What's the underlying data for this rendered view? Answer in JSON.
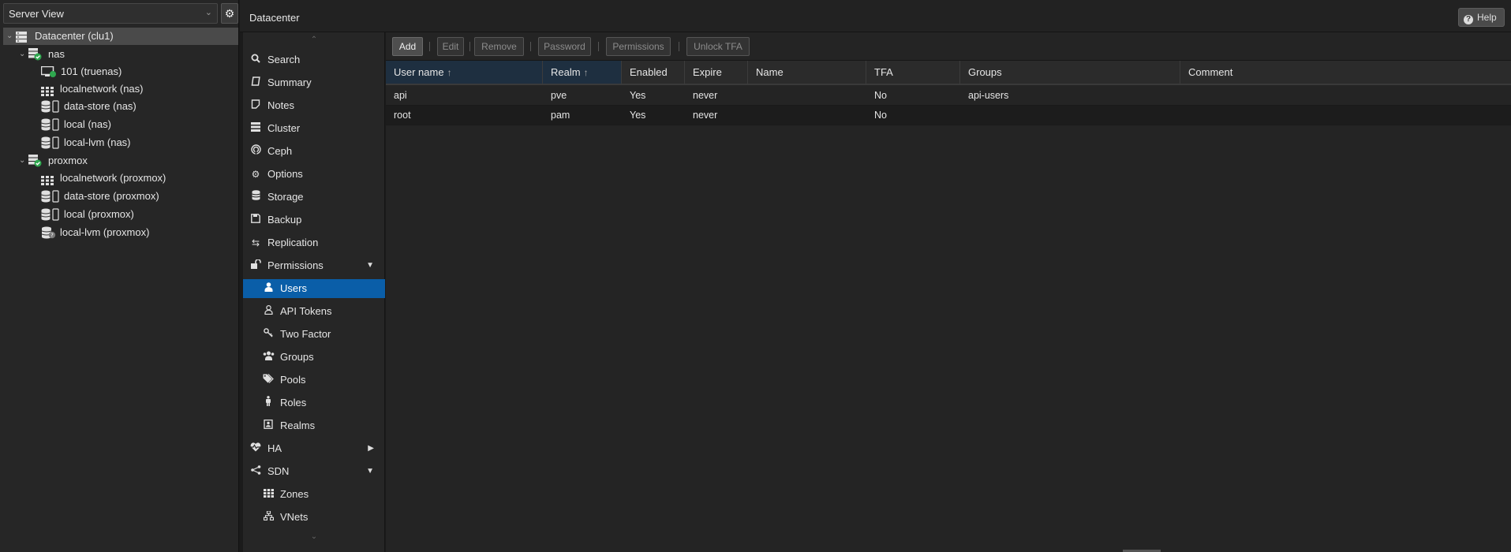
{
  "left_panel": {
    "view_select": {
      "value": "Server View"
    },
    "tree": [
      {
        "label": "Datacenter (clu1)",
        "type": "datacenter",
        "depth": 0,
        "expanded": true,
        "selected": true
      },
      {
        "label": "nas",
        "type": "node",
        "depth": 1,
        "expanded": true
      },
      {
        "label": "101 (truenas)",
        "type": "vm",
        "depth": 2
      },
      {
        "label": "localnetwork (nas)",
        "type": "sdn",
        "depth": 2
      },
      {
        "label": "data-store (nas)",
        "type": "storage",
        "depth": 2
      },
      {
        "label": "local (nas)",
        "type": "storage",
        "depth": 2
      },
      {
        "label": "local-lvm (nas)",
        "type": "storage",
        "depth": 2
      },
      {
        "label": "proxmox",
        "type": "node",
        "depth": 1,
        "expanded": true
      },
      {
        "label": "localnetwork (proxmox)",
        "type": "sdn",
        "depth": 2
      },
      {
        "label": "data-store (proxmox)",
        "type": "storage",
        "depth": 2
      },
      {
        "label": "local (proxmox)",
        "type": "storage",
        "depth": 2
      },
      {
        "label": "local-lvm (proxmox)",
        "type": "storage-unknown",
        "depth": 2
      }
    ]
  },
  "header": {
    "title": "Datacenter",
    "help_label": "Help"
  },
  "nav": {
    "items": [
      {
        "label": "Search",
        "icon": "search-icon",
        "sub": false
      },
      {
        "label": "Summary",
        "icon": "book-icon",
        "sub": false
      },
      {
        "label": "Notes",
        "icon": "notes-icon",
        "sub": false
      },
      {
        "label": "Cluster",
        "icon": "server-icon",
        "sub": false
      },
      {
        "label": "Ceph",
        "icon": "ceph-icon",
        "sub": false
      },
      {
        "label": "Options",
        "icon": "gear-icon",
        "sub": false
      },
      {
        "label": "Storage",
        "icon": "database-icon",
        "sub": false
      },
      {
        "label": "Backup",
        "icon": "floppy-icon",
        "sub": false
      },
      {
        "label": "Replication",
        "icon": "retweet-icon",
        "sub": false
      },
      {
        "label": "Permissions",
        "icon": "unlock-icon",
        "sub": false,
        "expander": "down"
      },
      {
        "label": "Users",
        "icon": "user-icon",
        "sub": true,
        "selected": true
      },
      {
        "label": "API Tokens",
        "icon": "user-outline-icon",
        "sub": true
      },
      {
        "label": "Two Factor",
        "icon": "key-icon",
        "sub": true
      },
      {
        "label": "Groups",
        "icon": "users-icon",
        "sub": true
      },
      {
        "label": "Pools",
        "icon": "tags-icon",
        "sub": true
      },
      {
        "label": "Roles",
        "icon": "male-icon",
        "sub": true
      },
      {
        "label": "Realms",
        "icon": "address-book-icon",
        "sub": true
      },
      {
        "label": "HA",
        "icon": "heartbeat-icon",
        "sub": false,
        "expander": "right"
      },
      {
        "label": "SDN",
        "icon": "sdn-icon",
        "sub": false,
        "expander": "down"
      },
      {
        "label": "Zones",
        "icon": "grid-icon",
        "sub": true
      },
      {
        "label": "VNets",
        "icon": "network-icon",
        "sub": true
      }
    ]
  },
  "toolbar": {
    "add": "Add",
    "edit": "Edit",
    "remove": "Remove",
    "password": "Password",
    "permissions": "Permissions",
    "unlock_tfa": "Unlock TFA"
  },
  "grid": {
    "columns": [
      "User name",
      "Realm",
      "Enabled",
      "Expire",
      "Name",
      "TFA",
      "Groups",
      "Comment"
    ],
    "sorted_columns": [
      "User name",
      "Realm"
    ],
    "rows": [
      [
        "api",
        "pve",
        "Yes",
        "never",
        "",
        "No",
        "api-users",
        ""
      ],
      [
        "root",
        "pam",
        "Yes",
        "never",
        "",
        "No",
        "",
        ""
      ]
    ]
  },
  "colors": {
    "accent": "#0a5ea8",
    "running_status": "#2fa84f",
    "background": "#1b1b1b"
  }
}
